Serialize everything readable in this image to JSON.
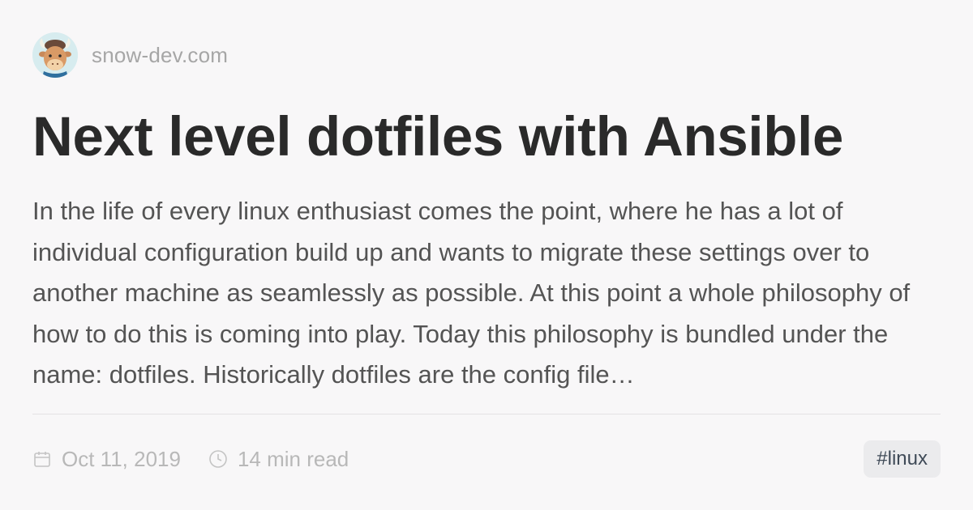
{
  "site": {
    "name": "snow-dev.com"
  },
  "post": {
    "title": "Next level dotfiles with Ansible",
    "excerpt": "In the life of every linux enthusiast comes the point, where he has a lot of individual configuration build up and wants to migrate these settings over to another machine as seamlessly as possible. At this point a whole philosophy of how to do this is coming into play. Today this philosophy is bundled under the name: dotfiles. Historically dotfiles are the config file…"
  },
  "meta": {
    "date": "Oct 11, 2019",
    "reading_time": "14 min read",
    "tag": "#linux"
  },
  "icons": {
    "avatar": "yak-avatar",
    "date": "calendar-icon",
    "reading_time": "clock-icon"
  },
  "colors": {
    "background": "#f8f7f8",
    "title": "#2a2a2a",
    "excerpt": "#545454",
    "muted": "#b8b8b8",
    "tag_bg": "#ebebed",
    "tag_text": "#3f4a57"
  }
}
